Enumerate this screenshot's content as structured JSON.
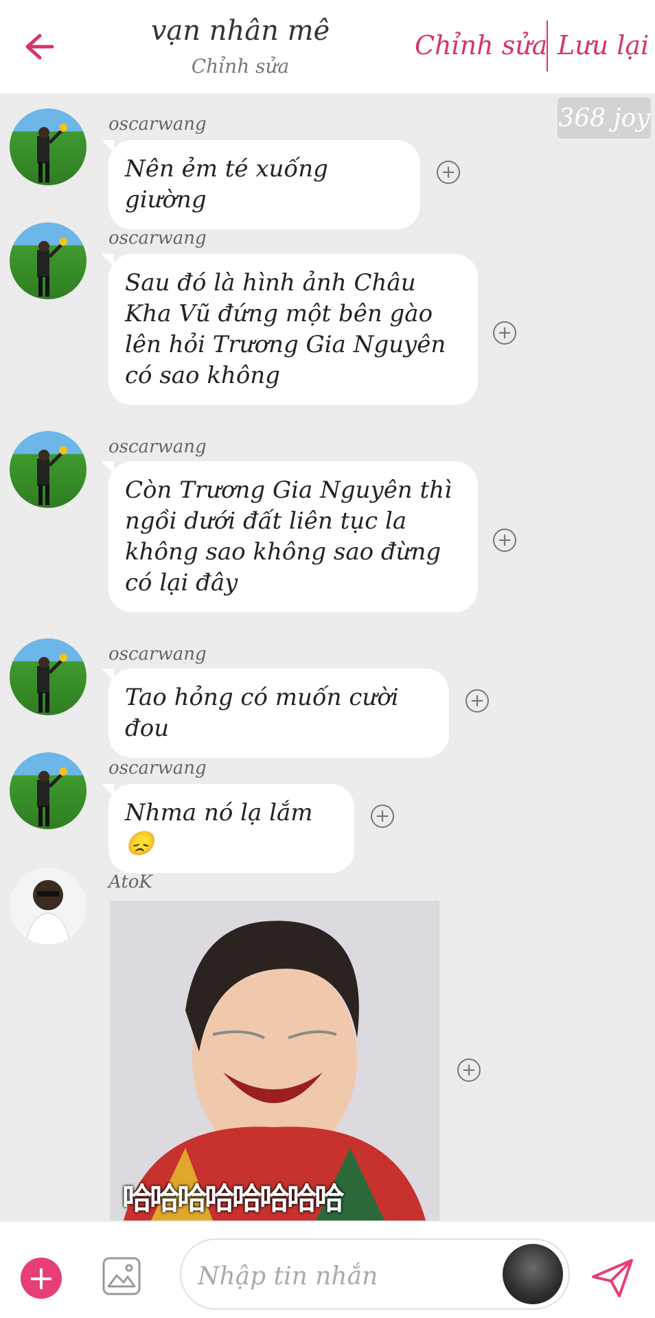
{
  "header": {
    "title": "vạn nhân mê",
    "subtitle": "Chỉnh sửa",
    "edit_label": "Chỉnh sửa",
    "save_label": "Lưu lại",
    "badge": "368 joy",
    "accent": "#d6336c"
  },
  "messages": [
    {
      "sender": "oscarwang",
      "text": "Nên ẻm té xuống giường"
    },
    {
      "sender": "oscarwang",
      "text": "Sau đó là hình ảnh Châu Kha Vũ đứng một bên gào lên hỏi Trương Gia Nguyên có sao không"
    },
    {
      "sender": "oscarwang",
      "text": "Còn Trương Gia Nguyên thì ngồi dưới đất liên tục la không sao không sao đừng có lại đây"
    },
    {
      "sender": "oscarwang",
      "text": "Tao hỏng có muốn cười đou"
    },
    {
      "sender": "oscarwang",
      "text": "Nhma nó lạ lắm 😞"
    },
    {
      "sender": "AtoK",
      "sticker_caption": "哈哈哈哈哈哈哈哈"
    }
  ],
  "composer": {
    "placeholder": "Nhập tin nhắn",
    "add_button": "+",
    "brand_color": "#e53e78"
  }
}
